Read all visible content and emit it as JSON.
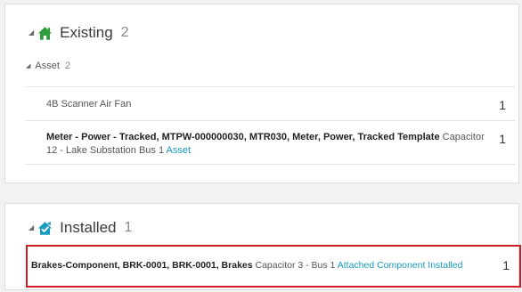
{
  "existing": {
    "title": "Existing",
    "count": "2",
    "icon": "home-icon",
    "icon_color": "#2e9e3e",
    "group": {
      "label": "Asset",
      "count": "2"
    },
    "rows": [
      {
        "text": "4B Scanner Air Fan",
        "qty": "1"
      },
      {
        "bold": "Meter - Power - Tracked, MTPW-000000030, MTR030, Meter, Power, Tracked Template",
        "text": " Capacitor 12 - Lake Substation Bus 1 ",
        "link": "Asset",
        "qty": "1"
      }
    ]
  },
  "installed": {
    "title": "Installed",
    "count": "1",
    "icon": "installed-home-check-icon",
    "icon_color": "#1a9cbf",
    "highlight_color": "#cc1f25",
    "row": {
      "bold": "Brakes-Component, BRK-0001, BRK-0001, Brakes",
      "text": " Capacitor 3 - Bus 1 ",
      "link": "Attached Component Installed",
      "qty": "1"
    }
  }
}
